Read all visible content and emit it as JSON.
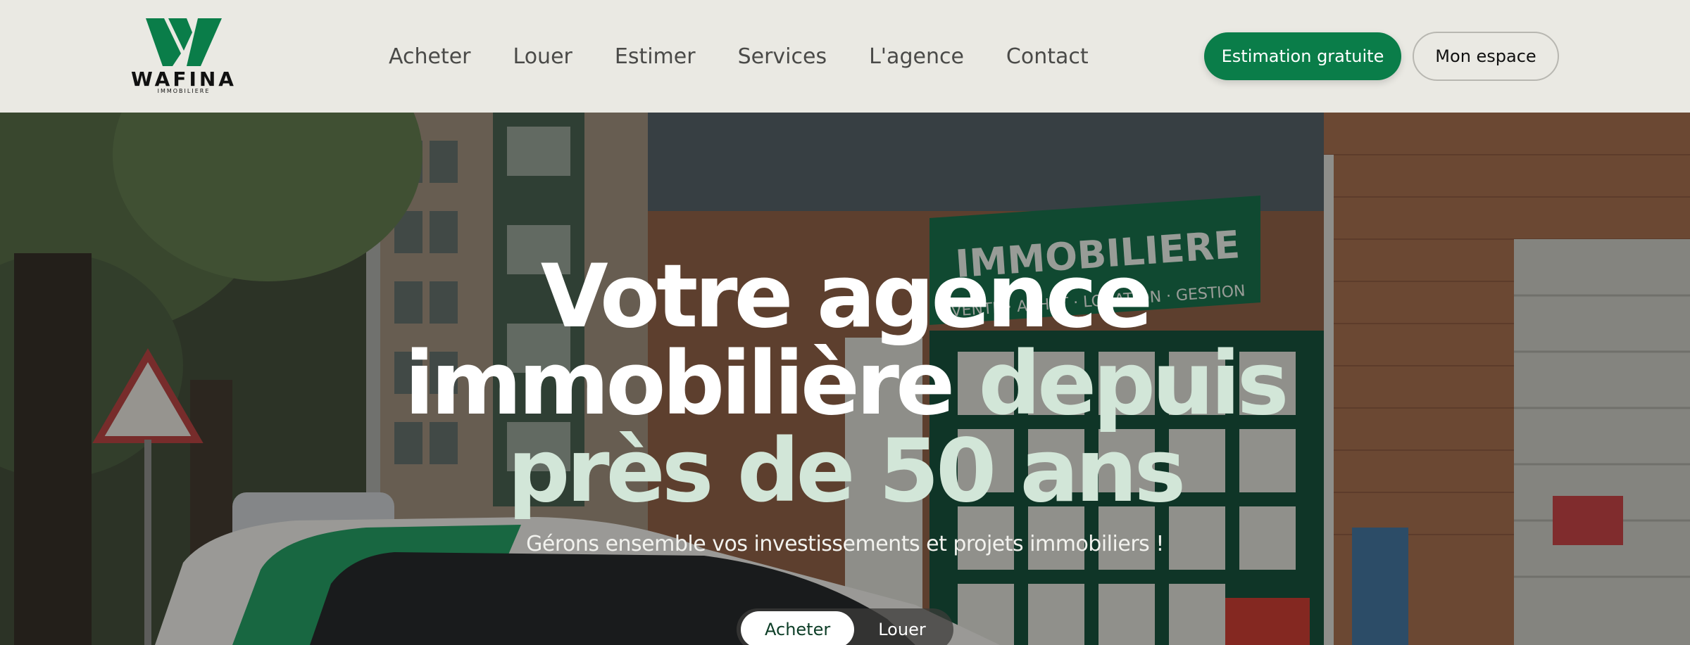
{
  "brand": {
    "name": "WAFINA",
    "tagline": "IMMOBILIERE",
    "accent_color": "#0a7d49"
  },
  "nav": {
    "items": [
      "Acheter",
      "Louer",
      "Estimer",
      "Services",
      "L'agence",
      "Contact"
    ]
  },
  "header_actions": {
    "estimation_label": "Estimation gratuite",
    "account_label": "Mon espace"
  },
  "hero": {
    "title_line1": "Votre agence",
    "title_line2_white": "immobilière",
    "title_line2_accent": "depuis",
    "title_line3_accent": "près de 50 ans",
    "subtitle": "Gérons ensemble vos investissements et projets immobiliers !",
    "accent_text_color": "#d2e6d8",
    "storefront_sign": "IMMOBILIERE",
    "storefront_subsign": "VENTE · ACHAT · LOCATION · GESTION"
  },
  "search_tabs": {
    "items": [
      "Acheter",
      "Louer"
    ],
    "active": "Acheter"
  }
}
